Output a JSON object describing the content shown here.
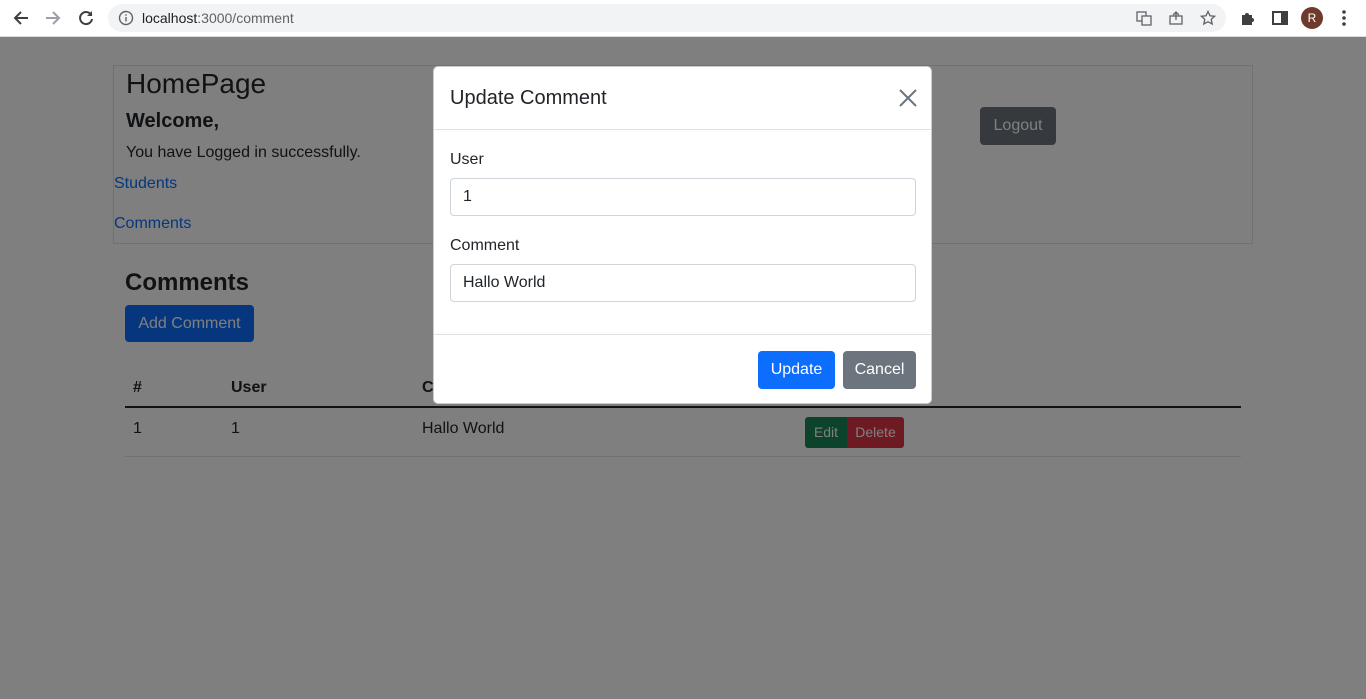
{
  "browser": {
    "url_host": "localhost",
    "url_path": ":3000/comment",
    "avatar_letter": "R"
  },
  "home": {
    "title": "HomePage",
    "welcome": "Welcome,",
    "logged_msg": "You have Logged in successfully.",
    "links": [
      "Students",
      "Comments"
    ],
    "logout_label": "Logout"
  },
  "comments": {
    "title": "Comments",
    "add_label": "Add Comment",
    "columns": [
      "#",
      "User",
      "Co"
    ],
    "rows": [
      {
        "id": "1",
        "user": "1",
        "comment": "Hallo World",
        "edit": "Edit",
        "delete": "Delete"
      }
    ]
  },
  "modal": {
    "title": "Update Comment",
    "user_label": "User",
    "user_value": "1",
    "comment_label": "Comment",
    "comment_value": "Hallo World",
    "update_label": "Update",
    "cancel_label": "Cancel"
  }
}
